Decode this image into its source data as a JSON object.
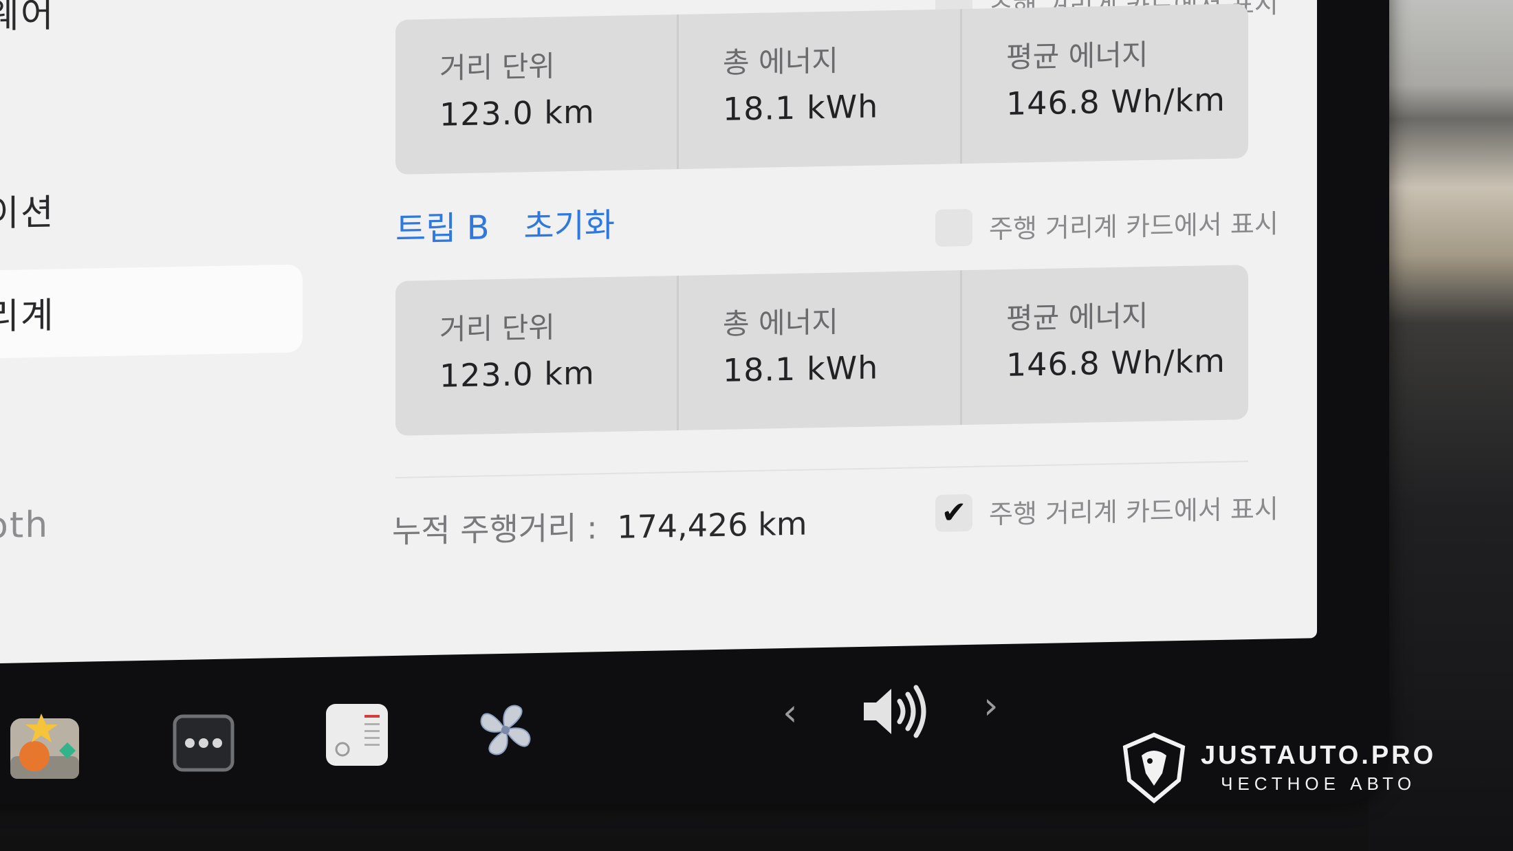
{
  "sidebar": {
    "items": [
      {
        "label": "웨어"
      },
      {
        "label": "이션"
      },
      {
        "label": "리계"
      },
      {
        "label": "oth"
      }
    ]
  },
  "trip_a": {
    "show_label": "주행 거리계 카드에서 표시",
    "show_checked": false,
    "cells": [
      {
        "label": "거리 단위",
        "value": "123.0  km"
      },
      {
        "label": "총 에너지",
        "value": "18.1  kWh"
      },
      {
        "label": "평균 에너지",
        "value": "146.8  Wh/km"
      }
    ]
  },
  "trip_b": {
    "title": "트립 B",
    "reset_label": "초기화",
    "show_label": "주행 거리계 카드에서 표시",
    "show_checked": false,
    "cells": [
      {
        "label": "거리 단위",
        "value": "123.0  km"
      },
      {
        "label": "총 에너지",
        "value": "18.1  kWh"
      },
      {
        "label": "평균 에너지",
        "value": "146.8  Wh/km"
      }
    ]
  },
  "odometer": {
    "label": "누적 주행거리 :",
    "value": "174,426  km",
    "show_label": "주행 거리계 카드에서 표시",
    "show_checked": true,
    "check_glyph": "✔"
  },
  "taskbar": {
    "icons": [
      "photo-app-icon",
      "more-apps-icon",
      "calendar-icon",
      "fan-icon",
      "volume-icon"
    ],
    "prev_glyph": "‹",
    "next_glyph": "›"
  },
  "watermark": {
    "brand": "JUSTAUTO.PRO",
    "tagline": "ЧЕСТНОЕ АВТО"
  }
}
